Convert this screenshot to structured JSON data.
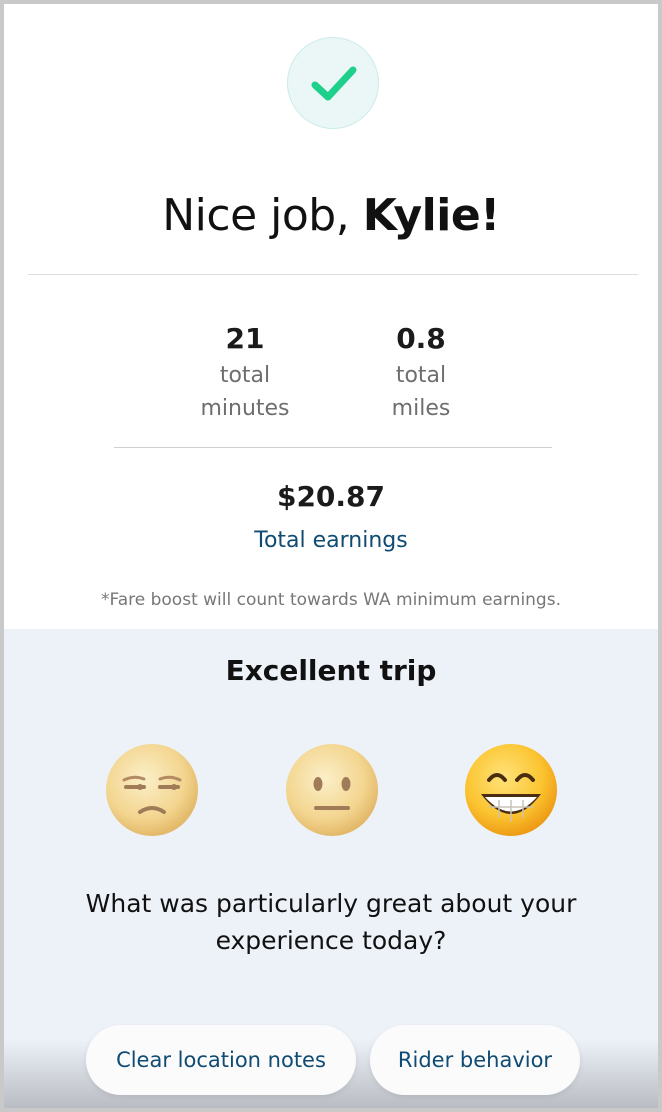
{
  "header": {
    "greeting_prefix": "Nice job, ",
    "greeting_name": "Kylie!",
    "icon": "check-icon",
    "accent_color": "#1fcf8c"
  },
  "stats": [
    {
      "value": "21",
      "label_line1": "total",
      "label_line2": "minutes"
    },
    {
      "value": "0.8",
      "label_line1": "total",
      "label_line2": "miles"
    }
  ],
  "earnings": {
    "amount": "$20.87",
    "label": "Total earnings",
    "note": "*Fare boost will count towards WA minimum earnings."
  },
  "rating": {
    "title": "Excellent trip",
    "options": [
      {
        "icon": "unamused-face-icon",
        "selected": false
      },
      {
        "icon": "neutral-face-icon",
        "selected": false
      },
      {
        "icon": "grinning-face-icon",
        "selected": true
      }
    ],
    "question": "What was particularly great about your experience today?",
    "chips": [
      "Clear location notes",
      "Rider behavior"
    ]
  }
}
